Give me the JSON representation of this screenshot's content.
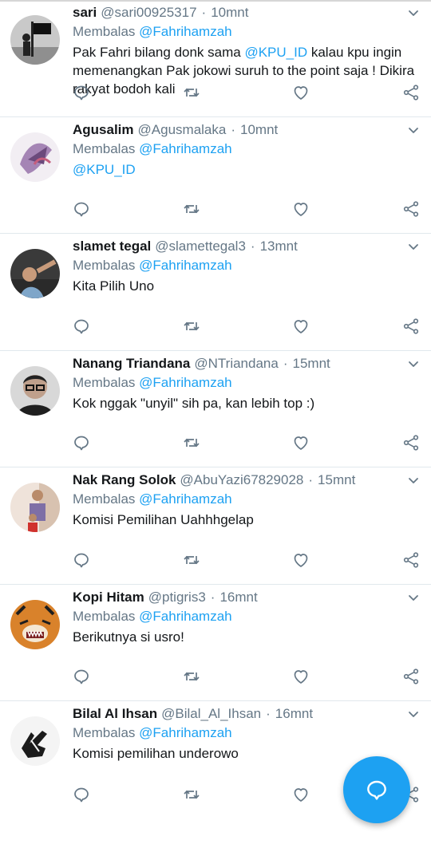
{
  "tweets": [
    {
      "name": "sari",
      "handle": "@sari00925317",
      "sep": "·",
      "time": "10mnt",
      "reply_prefix": "Membalas",
      "reply_to": "@Fahrihamzah",
      "parts": [
        {
          "t": "Pak Fahri bilang donk sama "
        },
        {
          "t": "@KPU_ID",
          "m": true
        },
        {
          "t": " kalau kpu ingin memenangkan Pak jokowi suruh to the point saja ! Dikira rakyat bodoh kali"
        }
      ]
    },
    {
      "name": "Agusalim",
      "handle": "@Agusmalaka",
      "sep": "·",
      "time": "10mnt",
      "reply_prefix": "Membalas",
      "reply_to": "@Fahrihamzah",
      "parts": [
        {
          "t": "@KPU_ID",
          "m": true
        }
      ]
    },
    {
      "name": "slamet tegal",
      "handle": "@slamettegal3",
      "sep": "·",
      "time": "13mnt",
      "reply_prefix": "Membalas",
      "reply_to": "@Fahrihamzah",
      "parts": [
        {
          "t": "Kita Pilih Uno"
        }
      ]
    },
    {
      "name": "Nanang Triandana",
      "handle": "@NTriandana",
      "sep": "·",
      "time": "15mnt",
      "reply_prefix": "Membalas",
      "reply_to": "@Fahrihamzah",
      "parts": [
        {
          "t": "Kok nggak \"unyil\" sih pa, kan lebih top :)"
        }
      ]
    },
    {
      "name": "Nak Rang Solok",
      "handle": "@AbuYazi67829028",
      "sep": "·",
      "time": "15mnt",
      "reply_prefix": "Membalas",
      "reply_to": "@Fahrihamzah",
      "parts": [
        {
          "t": "Komisi Pemilihan Uahhhgelap"
        }
      ]
    },
    {
      "name": "Kopi Hitam",
      "handle": "@ptigris3",
      "sep": "·",
      "time": "16mnt",
      "reply_prefix": "Membalas",
      "reply_to": "@Fahrihamzah",
      "parts": [
        {
          "t": "Berikutnya si usro!"
        }
      ]
    },
    {
      "name": "Bilal Al Ihsan",
      "handle": "@Bilal_Al_Ihsan",
      "sep": "·",
      "time": "16mnt",
      "reply_prefix": "Membalas",
      "reply_to": "@Fahrihamzah",
      "parts": [
        {
          "t": "Komisi pemilihan underowo"
        }
      ]
    }
  ],
  "avatars": [
    "flag-figure",
    "abstract-art",
    "person-photo",
    "glasses-man",
    "child-photo",
    "tiger",
    "hand-sign"
  ],
  "icons": {
    "reply": "reply-icon",
    "retweet": "retweet-icon",
    "like": "like-icon",
    "share": "share-icon",
    "caret": "chevron-down-icon",
    "compose": "compose-reply-icon"
  },
  "colors": {
    "accent": "#1da1f2",
    "muted": "#657786",
    "text": "#14171a",
    "divider": "#e1e8ed"
  }
}
